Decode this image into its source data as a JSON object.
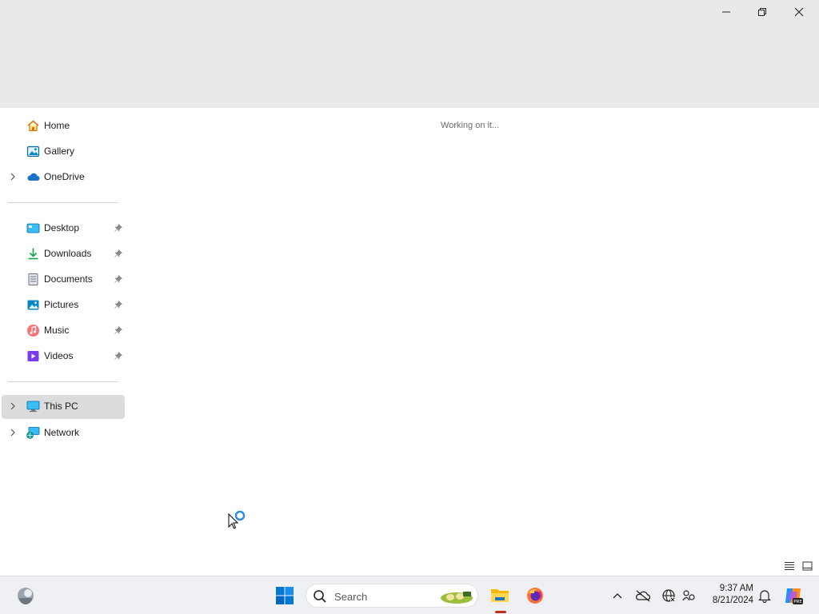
{
  "window": {
    "controls": {
      "minimize_icon": "minimize-icon",
      "restore_icon": "restore-icon",
      "close_icon": "close-icon"
    }
  },
  "sidebar": {
    "quick_items": [
      {
        "label": "Home",
        "icon": "home-icon"
      },
      {
        "label": "Gallery",
        "icon": "gallery-icon"
      },
      {
        "label": "OneDrive",
        "icon": "onedrive-cloud-icon",
        "expandable": true
      }
    ],
    "pinned_items": [
      {
        "label": "Desktop",
        "icon": "desktop-folder-icon",
        "pinned": true
      },
      {
        "label": "Downloads",
        "icon": "downloads-icon",
        "pinned": true
      },
      {
        "label": "Documents",
        "icon": "documents-icon",
        "pinned": true
      },
      {
        "label": "Pictures",
        "icon": "pictures-icon",
        "pinned": true
      },
      {
        "label": "Music",
        "icon": "music-icon",
        "pinned": true
      },
      {
        "label": "Videos",
        "icon": "videos-icon",
        "pinned": true
      }
    ],
    "device_items": [
      {
        "label": "This PC",
        "icon": "this-pc-icon",
        "expandable": true,
        "selected": true
      },
      {
        "label": "Network",
        "icon": "network-icon",
        "expandable": true
      }
    ]
  },
  "content": {
    "status": "Working on it..."
  },
  "taskbar": {
    "search_placeholder": "Search",
    "clock": {
      "time": "9:37 AM",
      "date": "8/21/2024"
    },
    "pinned_apps": [
      "start-button",
      "file-explorer",
      "firefox"
    ],
    "tray_icons": [
      "chevron-up-icon",
      "onedrive-offline-icon",
      "network-globe-icon",
      "accessibility-icon",
      "notification-bell-icon",
      "copilot-pre-icon"
    ]
  },
  "colors": {
    "titlebar_bg": "#e9e9e9",
    "selected_bg": "#dcdcdc",
    "taskbar_bg": "#eef0f3",
    "accent_blue": "#0078d4",
    "indicator_red": "#c42b1c"
  }
}
